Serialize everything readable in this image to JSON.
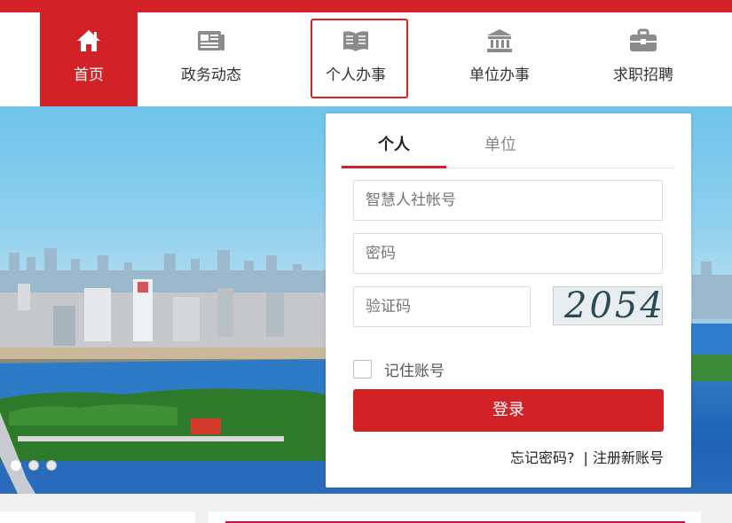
{
  "colors": {
    "brand_red": "#d22127",
    "highlight": "#e0201f"
  },
  "nav": {
    "items": [
      {
        "label": "首页",
        "icon": "home-icon",
        "active": true
      },
      {
        "label": "政务动态",
        "icon": "newspaper-icon"
      },
      {
        "label": "个人办事",
        "icon": "book-icon",
        "highlighted": true
      },
      {
        "label": "单位办事",
        "icon": "bank-icon"
      },
      {
        "label": "求职招聘",
        "icon": "briefcase-icon"
      }
    ]
  },
  "login": {
    "tabs": [
      "个人",
      "单位"
    ],
    "active_tab": "个人",
    "account_placeholder": "智慧人社帐号",
    "password_placeholder": "密码",
    "captcha_placeholder": "验证码",
    "captcha_code": "2054",
    "remember_label": "记住账号",
    "submit_label": "登录",
    "forgot_label": "忘记密码?",
    "register_label": "| 注册新账号"
  },
  "carousel": {
    "slides": 3,
    "active": 0
  }
}
